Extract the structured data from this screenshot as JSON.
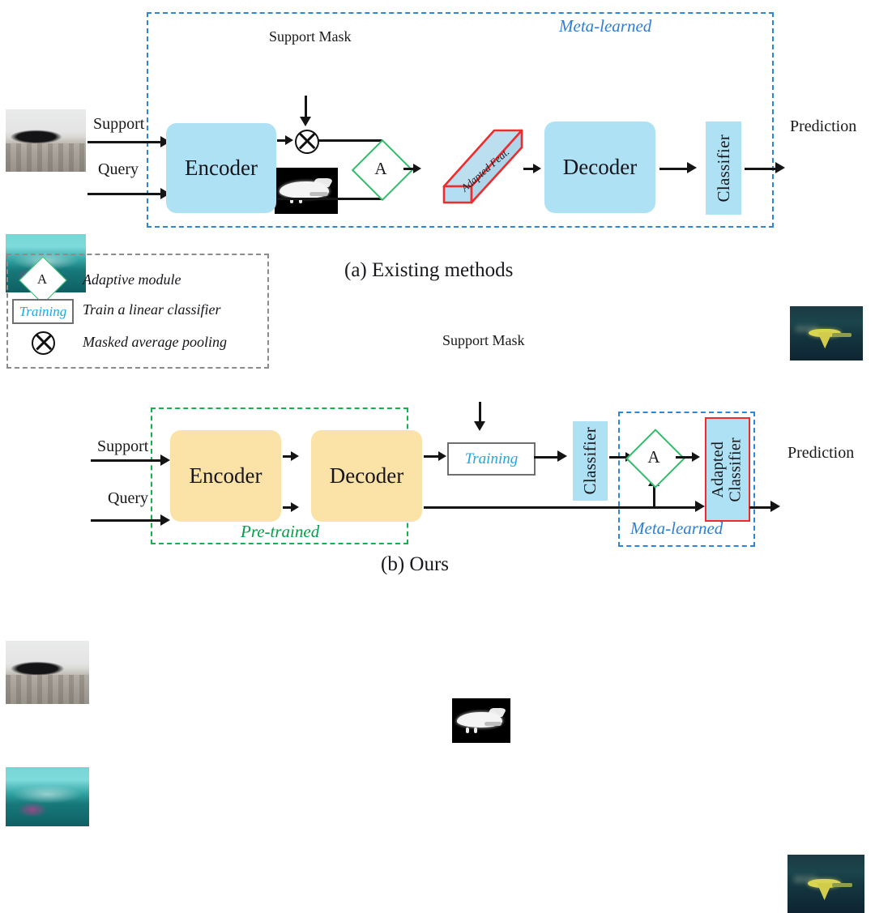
{
  "figure": {
    "caption_a": "(a) Existing methods",
    "caption_b": "(b) Ours"
  },
  "panel_a": {
    "region_label": "Meta-learned",
    "inputs": {
      "support_label": "Support",
      "query_label": "Query",
      "support_image_alt": "support-image-airplane-on-ground",
      "query_image_alt": "query-image-airplane-over-water"
    },
    "support_mask": {
      "title": "Support Mask",
      "image_alt": "binary-mask-airplane"
    },
    "encoder_label": "Encoder",
    "pooling_symbol": "masked-average-pooling",
    "adaptive_module_label": "A",
    "adapted_feature_label": "Adapted Feat.",
    "decoder_label": "Decoder",
    "classifier_label": "Classifier",
    "prediction": {
      "title": "Prediction",
      "image_alt": "prediction-segmentation-airplane"
    }
  },
  "legend": {
    "items": [
      {
        "symbol": "A",
        "symbol_kind": "diamond",
        "text": "Adaptive module"
      },
      {
        "symbol": "Training",
        "symbol_kind": "box",
        "text": "Train a linear classifier"
      },
      {
        "symbol": "⊗",
        "symbol_kind": "circle-times",
        "text": "Masked average pooling"
      }
    ]
  },
  "panel_b": {
    "pretrained_label": "Pre-trained",
    "meta_learned_label": "Meta-learned",
    "inputs": {
      "support_label": "Support",
      "query_label": "Query",
      "support_image_alt": "support-image-airplane-on-ground",
      "query_image_alt": "query-image-airplane-over-water"
    },
    "support_mask": {
      "title": "Support Mask",
      "image_alt": "binary-mask-airplane"
    },
    "encoder_label": "Encoder",
    "decoder_label": "Decoder",
    "training_label": "Training",
    "classifier_label": "Classifier",
    "adaptive_module_label": "A",
    "adapted_classifier_line1": "Adapted",
    "adapted_classifier_line2": "Classifier",
    "prediction": {
      "title": "Prediction",
      "image_alt": "prediction-segmentation-airplane"
    }
  },
  "colors": {
    "blue_fill": "#aee1f4",
    "yellow_fill": "#fbe2a6",
    "dashed_blue": "#2f86d6",
    "dashed_green": "#13b24b",
    "red_outline": "#ef2b2b",
    "green_diamond": "#2fbd6a",
    "cyan_text": "#1aa9e8"
  }
}
